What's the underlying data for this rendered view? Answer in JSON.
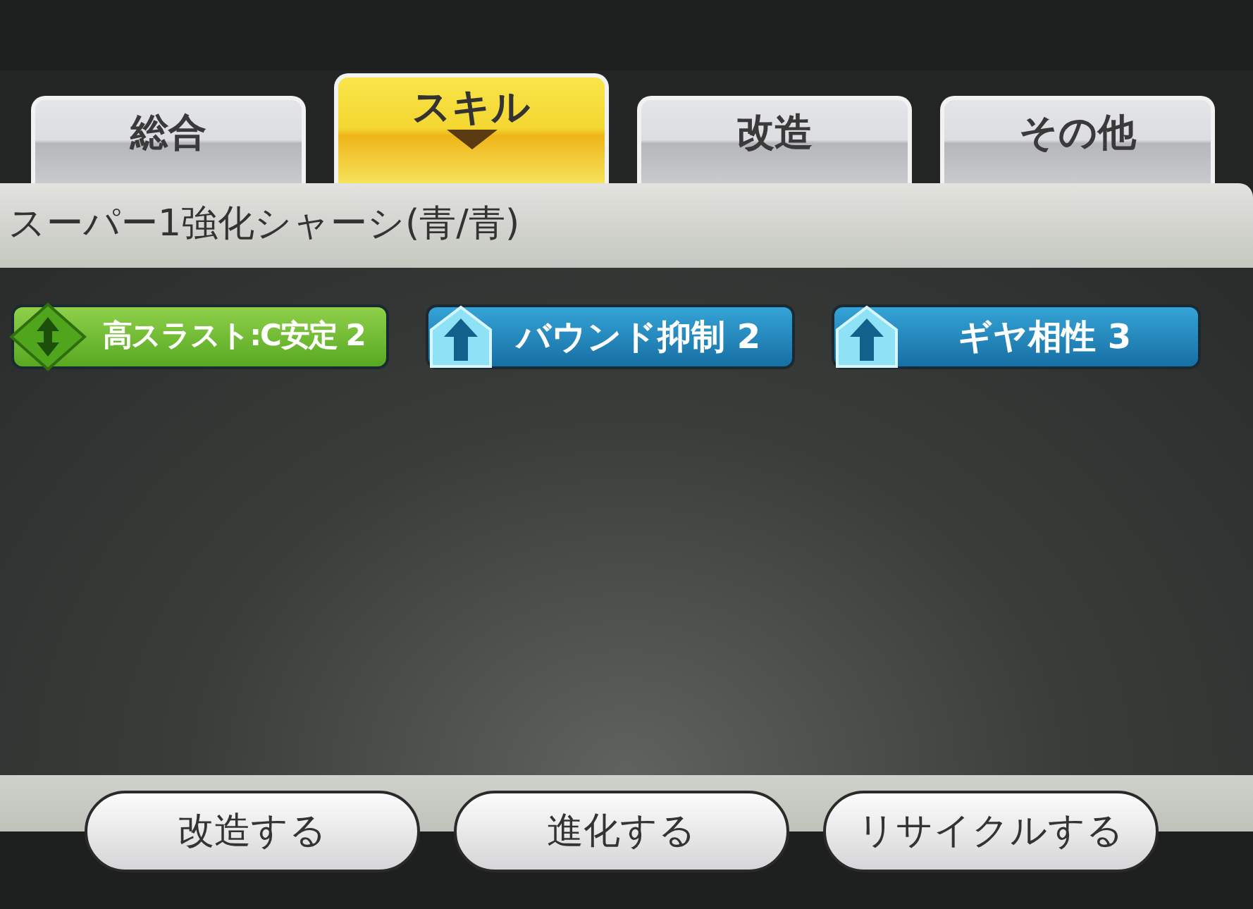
{
  "tabs": [
    {
      "label": "総合",
      "selected": false
    },
    {
      "label": "スキル",
      "selected": true
    },
    {
      "label": "改造",
      "selected": false
    },
    {
      "label": "その他",
      "selected": false
    }
  ],
  "part_name": "スーパー1強化シャーシ(青/青)",
  "skills": [
    {
      "kind": "diamond",
      "label": "高スラスト:C安定 2"
    },
    {
      "kind": "up",
      "label": "バウンド抑制 2"
    },
    {
      "kind": "up",
      "label": "ギヤ相性 3"
    }
  ],
  "buttons": [
    "改造する",
    "進化する",
    "リサイクルする"
  ]
}
